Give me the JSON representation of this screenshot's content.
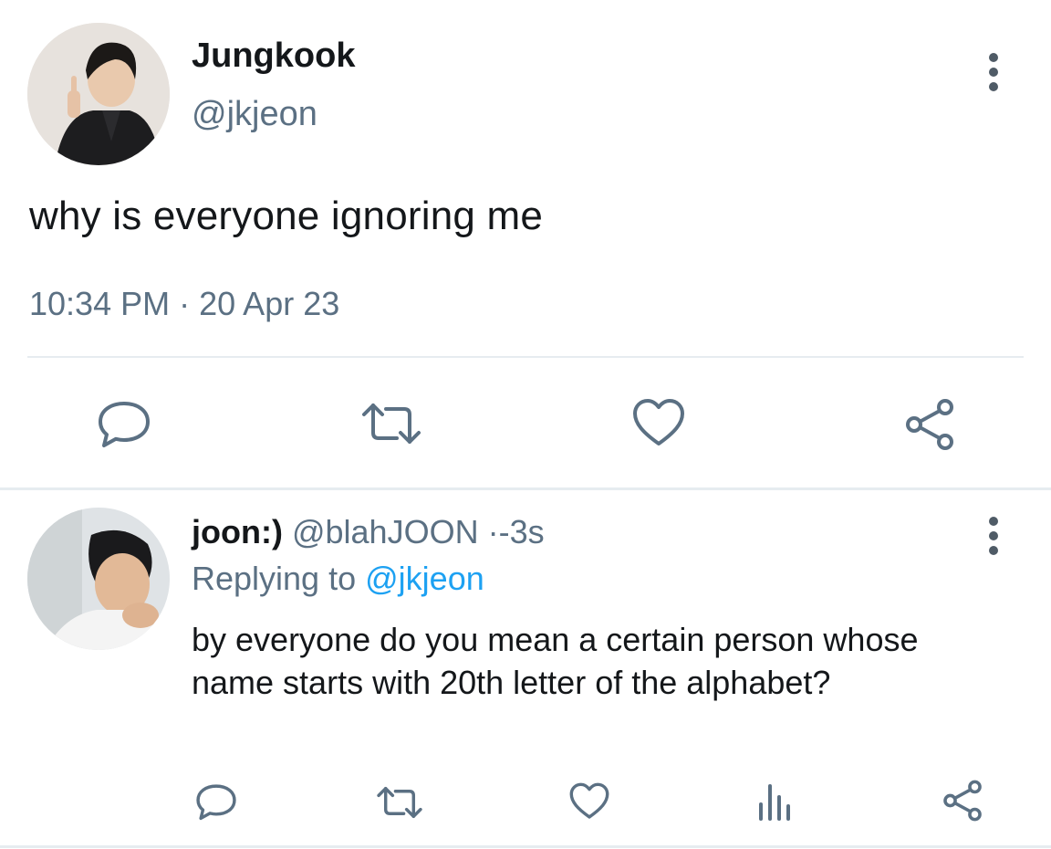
{
  "main_tweet": {
    "author_name": "Jungkook",
    "author_handle": "@jkjeon",
    "text": "why is everyone ignoring me",
    "time": "10:34 PM",
    "date_separator": "·",
    "date": "20 Apr 23",
    "actions": [
      "reply-icon",
      "retweet-icon",
      "like-icon",
      "share-icon"
    ]
  },
  "reply_tweet": {
    "author_name": "joon:)",
    "author_handle": "@blahJOON",
    "separator": "·",
    "age": "-3s",
    "replying_prefix": "Replying to",
    "replying_handle": "@jkjeon",
    "text": "by everyone do you mean a certain person whose name starts with 20th letter of the alphabet?",
    "actions": [
      "reply-icon",
      "retweet-icon",
      "like-icon",
      "analytics-icon",
      "share-icon"
    ]
  },
  "colors": {
    "text_primary": "#14171a",
    "text_secondary": "#5b7083",
    "link": "#1da1f2",
    "divider": "#e6ecf0"
  }
}
